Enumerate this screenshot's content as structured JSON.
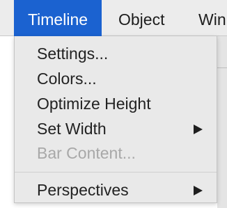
{
  "menubar": {
    "items": [
      {
        "label": "Timeline",
        "active": true
      },
      {
        "label": "Object",
        "active": false
      },
      {
        "label": "Win",
        "active": false
      }
    ],
    "active_color": "#1b62d0"
  },
  "dropdown": {
    "items": [
      {
        "label": "Settings...",
        "enabled": true,
        "submenu": false
      },
      {
        "label": "Colors...",
        "enabled": true,
        "submenu": false
      },
      {
        "label": "Optimize Height",
        "enabled": true,
        "submenu": false
      },
      {
        "label": "Set Width",
        "enabled": true,
        "submenu": true,
        "icon": "submenu-arrow-icon"
      },
      {
        "label": "Bar Content...",
        "enabled": false,
        "submenu": false
      },
      {
        "label": "Perspectives",
        "enabled": true,
        "submenu": true,
        "icon": "submenu-arrow-icon"
      }
    ]
  }
}
